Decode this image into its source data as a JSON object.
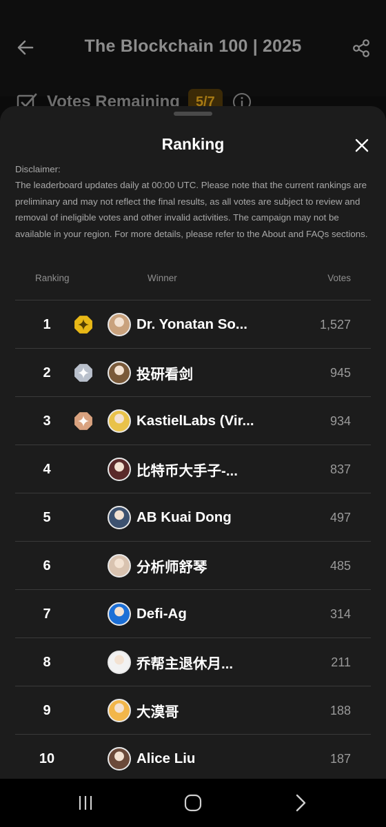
{
  "header": {
    "title": "The Blockchain 100 | 2025",
    "back_icon": "arrow-left-icon",
    "share_icon": "share-icon"
  },
  "votes_remaining": {
    "label": "Votes Remaining",
    "value": "5/7",
    "accent_color": "#a77a14"
  },
  "sheet": {
    "title": "Ranking",
    "close_icon": "close-icon",
    "disclaimer_title": "Disclaimer:",
    "disclaimer_text": "The leaderboard updates daily at 00:00 UTC. Please note that the current rankings are preliminary and may not reflect the final results, as all votes are subject to review and removal of ineligible votes and other invalid activities. The campaign may not be available in your region. For more details, please refer to the About and FAQs sections.",
    "columns": {
      "rank": "Ranking",
      "winner": "Winner",
      "votes": "Votes"
    },
    "rows": [
      {
        "rank": "1",
        "medal": "gold",
        "name": "Dr. Yonatan So...",
        "votes": "1,527",
        "avatar_color": "#c9a27d"
      },
      {
        "rank": "2",
        "medal": "silver",
        "name": "投研看剑",
        "votes": "945",
        "avatar_color": "#7a5a3a"
      },
      {
        "rank": "3",
        "medal": "bronze",
        "name": "KastielLabs (Vir...",
        "votes": "934",
        "avatar_color": "#e9c24a"
      },
      {
        "rank": "4",
        "medal": "",
        "name": "比特币大手子-...",
        "votes": "837",
        "avatar_color": "#5a2a2a"
      },
      {
        "rank": "5",
        "medal": "",
        "name": "AB Kuai Dong",
        "votes": "497",
        "avatar_color": "#3d5270"
      },
      {
        "rank": "6",
        "medal": "",
        "name": "分析师舒琴",
        "votes": "485",
        "avatar_color": "#d9c3b0"
      },
      {
        "rank": "7",
        "medal": "",
        "name": "Defi-Ag",
        "votes": "314",
        "avatar_color": "#1c6fd6"
      },
      {
        "rank": "8",
        "medal": "",
        "name": "乔帮主退休月...",
        "votes": "211",
        "avatar_color": "#f2f2f2"
      },
      {
        "rank": "9",
        "medal": "",
        "name": "大漠哥",
        "votes": "188",
        "avatar_color": "#f2b64a"
      },
      {
        "rank": "10",
        "medal": "",
        "name": "Alice Liu",
        "votes": "187",
        "avatar_color": "#6b4a3a"
      }
    ],
    "medal_colors": {
      "gold": "#e8b816",
      "silver": "#b9c0cc",
      "bronze": "#d9a27f"
    }
  },
  "navbar": {
    "recents_icon": "recents-icon",
    "home_icon": "home-icon",
    "back_icon": "nav-back-icon"
  }
}
